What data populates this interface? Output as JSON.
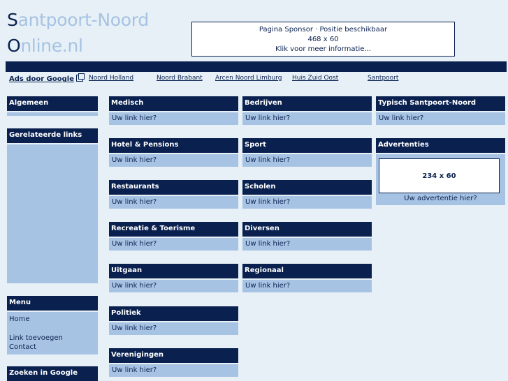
{
  "site": {
    "logo_line1_cap": "S",
    "logo_line1_rest": "antpoort-Noord",
    "logo_line2_cap": "O",
    "logo_line2_rest": "nline.nl"
  },
  "banner": {
    "line1": "Pagina Sponsor · Positie beschikbaar",
    "line2": "468 x 60",
    "line3": "Klik voor meer informatie..."
  },
  "ads_bar": {
    "google_label": "Ads door Google",
    "links": [
      "Noord Holland",
      "Noord Brabant",
      "Arcen Noord Limburg",
      "Huis Zuid Oost",
      "Santpoort"
    ]
  },
  "left": {
    "algemeen": "Algemeen",
    "gerelateerde": "Gerelateerde links",
    "menu_title": "Menu",
    "menu_items": [
      "Home",
      "Link toevoegen",
      "Contact"
    ],
    "zoeken": "Zoeken in Google"
  },
  "categories": {
    "col1": [
      {
        "title": "Medisch",
        "link": "Uw link hier?"
      },
      {
        "title": "Hotel & Pensions",
        "link": "Uw link hier?"
      },
      {
        "title": "Restaurants",
        "link": "Uw link hier?"
      },
      {
        "title": "Recreatie & Toerisme",
        "link": "Uw link hier?"
      },
      {
        "title": "Uitgaan",
        "link": "Uw link hier?"
      },
      {
        "title": "Politiek",
        "link": "Uw link hier?"
      },
      {
        "title": "Verenigingen",
        "link": "Uw link hier?"
      }
    ],
    "col2": [
      {
        "title": "Bedrijven",
        "link": "Uw link hier?"
      },
      {
        "title": "Sport",
        "link": "Uw link hier?"
      },
      {
        "title": "Scholen",
        "link": "Uw link hier?"
      },
      {
        "title": "Diversen",
        "link": "Uw link hier?"
      },
      {
        "title": "Regionaal",
        "link": "Uw link hier?"
      }
    ]
  },
  "right": {
    "typisch_title": "Typisch Santpoort-Noord",
    "typisch_link": "Uw link hier?",
    "advertenties_title": "Advertenties",
    "ad_size": "234 x 60",
    "ad_link": "Uw advertentie hier?"
  }
}
